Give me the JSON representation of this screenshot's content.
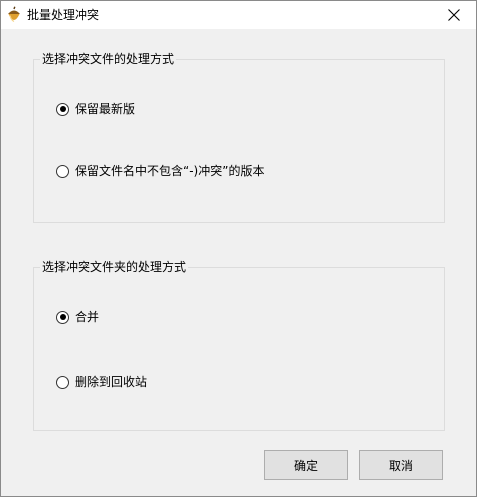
{
  "window": {
    "title": "批量处理冲突",
    "app_icon": "acorn-icon",
    "close_icon": "close-icon"
  },
  "file_group": {
    "legend": "选择冲突文件的处理方式",
    "options": [
      {
        "label": "保留最新版",
        "checked": true
      },
      {
        "label": "保留文件名中不包含“-)冲突”的版本",
        "checked": false
      }
    ]
  },
  "folder_group": {
    "legend": "选择冲突文件夹的处理方式",
    "options": [
      {
        "label": "合并",
        "checked": true
      },
      {
        "label": "删除到回收站",
        "checked": false
      }
    ]
  },
  "buttons": {
    "ok_label": "确定",
    "cancel_label": "取消"
  }
}
